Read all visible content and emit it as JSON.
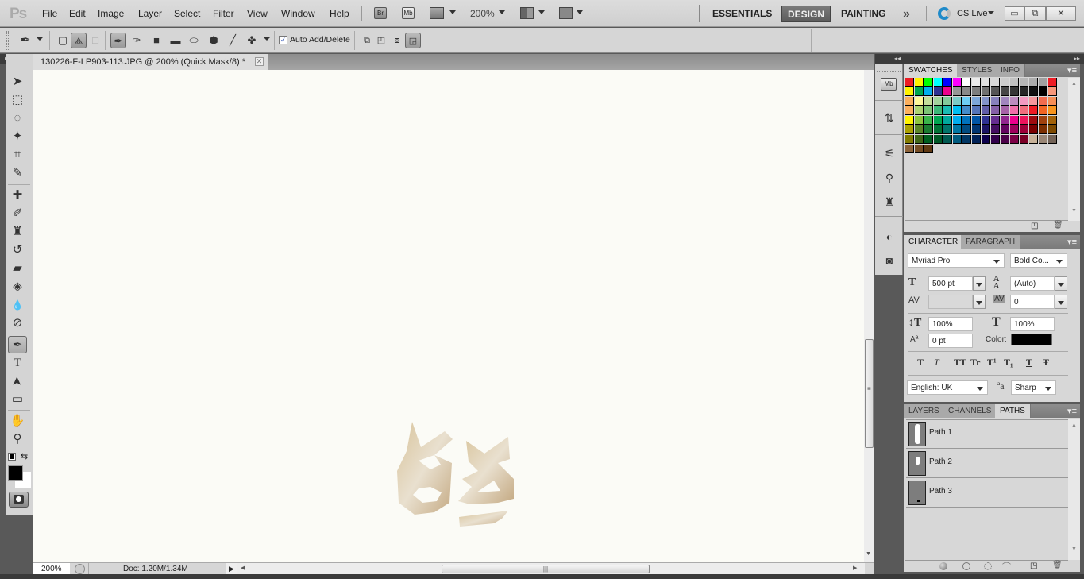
{
  "app": {
    "logo": "Ps"
  },
  "menu": [
    "File",
    "Edit",
    "Image",
    "Layer",
    "Select",
    "Filter",
    "View",
    "Window",
    "Help"
  ],
  "app_bar": {
    "bridge_label": "Br",
    "minibridge_label": "Mb",
    "zoom_level": "200%",
    "workspaces": [
      "ESSENTIALS",
      "DESIGN",
      "PAINTING"
    ],
    "active_workspace": "DESIGN",
    "more_label": "»",
    "cs_live_label": "CS Live",
    "window_buttons": {
      "minimize": "▭",
      "restore": "⧉",
      "close": "✕"
    }
  },
  "options_bar": {
    "auto_add_delete_label": "Auto Add/Delete",
    "auto_add_delete_checked": true
  },
  "document": {
    "tab_title": "130226-F-LP903-113.JPG @ 200% (Quick Mask/8) *",
    "close_symbol": "✕"
  },
  "status_bar": {
    "zoom": "200%",
    "doc_info": "Doc: 1.20M/1.34M"
  },
  "tools": [
    {
      "name": "move-tool",
      "glyph": "➤"
    },
    {
      "name": "marquee-tool",
      "glyph": "⬚"
    },
    {
      "name": "lasso-tool",
      "glyph": "◌"
    },
    {
      "name": "magic-wand-tool",
      "glyph": "✦"
    },
    {
      "name": "crop-tool",
      "glyph": "⌗"
    },
    {
      "name": "eyedropper-tool",
      "glyph": "✎"
    },
    {
      "name": "healing-brush-tool",
      "glyph": "✚"
    },
    {
      "name": "brush-tool",
      "glyph": "✐"
    },
    {
      "name": "clone-stamp-tool",
      "glyph": "♜"
    },
    {
      "name": "history-brush-tool",
      "glyph": "↺"
    },
    {
      "name": "eraser-tool",
      "glyph": "▰"
    },
    {
      "name": "paint-bucket-tool",
      "glyph": "◈"
    },
    {
      "name": "blur-tool",
      "glyph": "💧"
    },
    {
      "name": "dodge-tool",
      "glyph": "⊘"
    },
    {
      "name": "pen-tool",
      "glyph": "✒"
    },
    {
      "name": "type-tool",
      "glyph": "T"
    },
    {
      "name": "path-selection-tool",
      "glyph": "➤"
    },
    {
      "name": "rectangle-tool",
      "glyph": "▭"
    },
    {
      "name": "hand-tool",
      "glyph": "✋"
    },
    {
      "name": "zoom-tool",
      "glyph": "⚲"
    }
  ],
  "colors": {
    "foreground": "#000000",
    "background": "#ffffff",
    "accent_active_workspace": "#666666",
    "char_color": "#000000"
  },
  "swatches_panel": {
    "tabs": [
      "SWATCHES",
      "STYLES",
      "INFO"
    ],
    "active_tab": "SWATCHES",
    "rows": [
      [
        "#ed1c24",
        "#fff200",
        "#00ff00",
        "#00ffff",
        "#0000ff",
        "#ff00ff",
        "#ffffff",
        "#ebebeb",
        "#e1e1e1",
        "#d7d7d7",
        "#cccccc",
        "#c2c2c2",
        "#b7b7b7",
        "#acacac",
        "#a0a0a0",
        "#ed1c24"
      ],
      [
        "#fff200",
        "#00a651",
        "#00aeef",
        "#2e3192",
        "#ec008c",
        "#959595",
        "#898989",
        "#7d7d7d",
        "#707070",
        "#555555",
        "#464646",
        "#363636",
        "#262626",
        "#111111",
        "#000000",
        "#f7977a"
      ],
      [
        "#fbaf5d",
        "#fff799",
        "#c4df9b",
        "#a2d39c",
        "#82ca9c",
        "#7accc8",
        "#6dcff6",
        "#7da7d9",
        "#8393ca",
        "#8781bd",
        "#a186be",
        "#bd8cbf",
        "#f49ac1",
        "#f5989d",
        "#f26c4f",
        "#f68e56"
      ],
      [
        "#fbaf5d",
        "#acd372",
        "#7cc576",
        "#3bb878",
        "#1abbb4",
        "#00bff3",
        "#438ccb",
        "#5574b9",
        "#605ca8",
        "#855fa8",
        "#a763a8",
        "#f06eaa",
        "#f26d7d",
        "#ed1c24",
        "#f26522",
        "#f7941d"
      ],
      [
        "#fff200",
        "#8dc63f",
        "#39b54a",
        "#00a651",
        "#00a99d",
        "#00aeef",
        "#0072bc",
        "#0054a6",
        "#2e3192",
        "#662d91",
        "#92278f",
        "#ec008c",
        "#ed145b",
        "#9e0b0f",
        "#a0410d",
        "#a36209"
      ],
      [
        "#aba000",
        "#598527",
        "#197b30",
        "#007236",
        "#00746b",
        "#0076a3",
        "#004b80",
        "#003471",
        "#1b1464",
        "#440e62",
        "#630460",
        "#9e005d",
        "#9e0039",
        "#790000",
        "#7b2e00",
        "#7d4900"
      ],
      [
        "#827b00",
        "#406618",
        "#005e20",
        "#005826",
        "#005952",
        "#005b7f",
        "#003663",
        "#002157",
        "#0d004c",
        "#32004b",
        "#4b0049",
        "#7b0046",
        "#7a0026",
        "#c7b299",
        "#998675",
        "#736357"
      ],
      [
        "#8c6239",
        "#754c24",
        "#603913"
      ]
    ]
  },
  "character_panel": {
    "tabs": [
      "CHARACTER",
      "PARAGRAPH"
    ],
    "active_tab": "CHARACTER",
    "font_family": "Myriad Pro",
    "font_style": "Bold Co...",
    "font_size": "500 pt",
    "leading": "(Auto)",
    "kerning": "",
    "tracking": "0",
    "vertical_scale": "100%",
    "horizontal_scale": "100%",
    "baseline_shift": "0 pt",
    "color_label": "Color:",
    "style_buttons": [
      "T",
      "T",
      "TT",
      "Tr",
      "T¹",
      "T₁",
      "T",
      "Ŧ"
    ],
    "language": "English: UK",
    "aa_label": "ªa",
    "antialias": "Sharp"
  },
  "paths_panel": {
    "tabs": [
      "LAYERS",
      "CHANNELS",
      "PATHS"
    ],
    "active_tab": "PATHS",
    "paths": [
      "Path 1",
      "Path 2",
      "Path 3"
    ]
  }
}
